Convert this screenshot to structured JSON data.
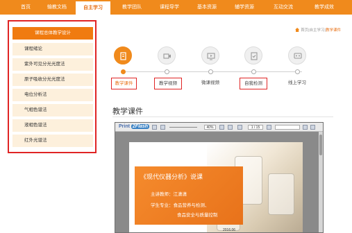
{
  "nav": {
    "items": [
      {
        "label": "首页"
      },
      {
        "label": "输教文档"
      },
      {
        "label": "自主学习"
      },
      {
        "label": "教学团队"
      },
      {
        "label": "课程导学"
      },
      {
        "label": "基本资源"
      },
      {
        "label": "辅学资源"
      },
      {
        "label": "互动交流"
      },
      {
        "label": "教学成效"
      }
    ],
    "active_index": 2,
    "color": "#f08a1c"
  },
  "sidebar": {
    "items": [
      {
        "label": "课程总体教学设计"
      },
      {
        "label": "课程绪论"
      },
      {
        "label": "紫外可见分光光度法"
      },
      {
        "label": "原子吸收分光光度法"
      },
      {
        "label": "电位分析法"
      },
      {
        "label": "气相色谱法"
      },
      {
        "label": "液相色谱法"
      },
      {
        "label": "红外光谱法"
      }
    ],
    "active_index": 0
  },
  "breadcrumb": {
    "prefix": "首页|自主学习|",
    "current": "教学课件"
  },
  "steps": {
    "items": [
      {
        "label": "教学课件",
        "icon": "document-icon"
      },
      {
        "label": "教学视频",
        "icon": "video-camera-icon"
      },
      {
        "label": "微课视频",
        "icon": "play-screen-icon"
      },
      {
        "label": "自我检测",
        "icon": "checklist-icon"
      },
      {
        "label": "线上学习",
        "icon": "online-learning-icon"
      }
    ],
    "active_index": 0
  },
  "section": {
    "title": "教学课件"
  },
  "viewer": {
    "logo_text": "Print",
    "logo_badge": "2Flash",
    "zoom": "40%",
    "page": "1 / 15",
    "slide": {
      "title": "《现代仪器分析》说课",
      "instructor": "主讲教师：江潇潇",
      "major_label": "学生专业：食品营养与检测、",
      "major_line2": "食品安全与质量控制",
      "date": "2016.06"
    }
  }
}
